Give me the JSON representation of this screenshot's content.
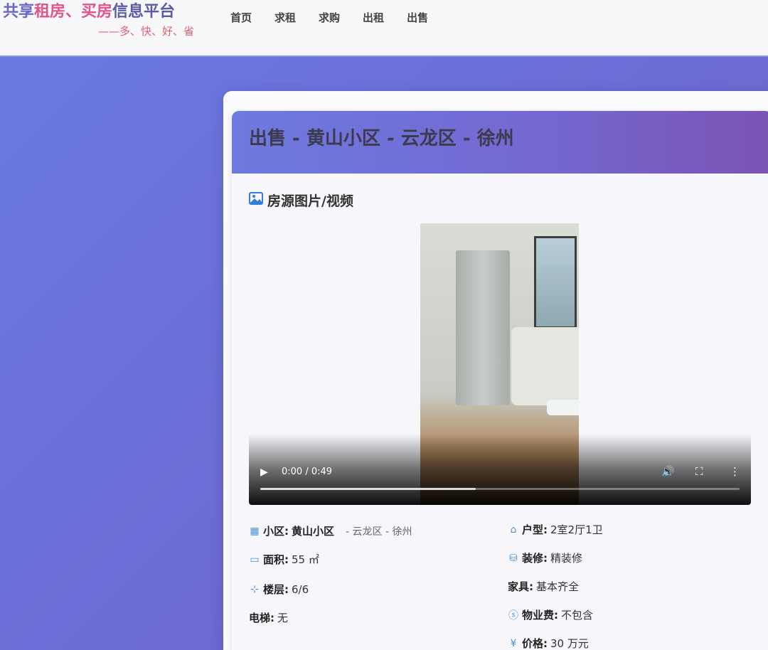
{
  "header": {
    "logo": {
      "part1": "共享",
      "part2": "租房、",
      "part3": "买房",
      "part4": "信息平台",
      "slogan": "——多、快、好、省"
    },
    "nav": [
      "首页",
      "求租",
      "求购",
      "出租",
      "出售"
    ]
  },
  "listing": {
    "title": "出售 - 黄山小区 - 云龙区 - 徐州",
    "media_section": "房源图片/视频",
    "video": {
      "time": "0:00 / 0:49",
      "progress": 0.45
    },
    "details": {
      "community_label": "小区:",
      "community_value": "黄山小区",
      "community_sub": "- 云龙区 - 徐州",
      "layout_label": "户型:",
      "layout_value": "2室2厅1卫",
      "area_label": "面积:",
      "area_value": "55 ㎡",
      "decor_label": "装修:",
      "decor_value": "精装修",
      "floor_label": "楼层:",
      "floor_value": "6/6",
      "furniture_label": "家具:",
      "furniture_value": "基本齐全",
      "elevator_label": "电梯:",
      "elevator_value": "无",
      "fee_label": "物业费:",
      "fee_value": "不包含",
      "price_label": "价格:",
      "price_value": "30 万元"
    }
  }
}
